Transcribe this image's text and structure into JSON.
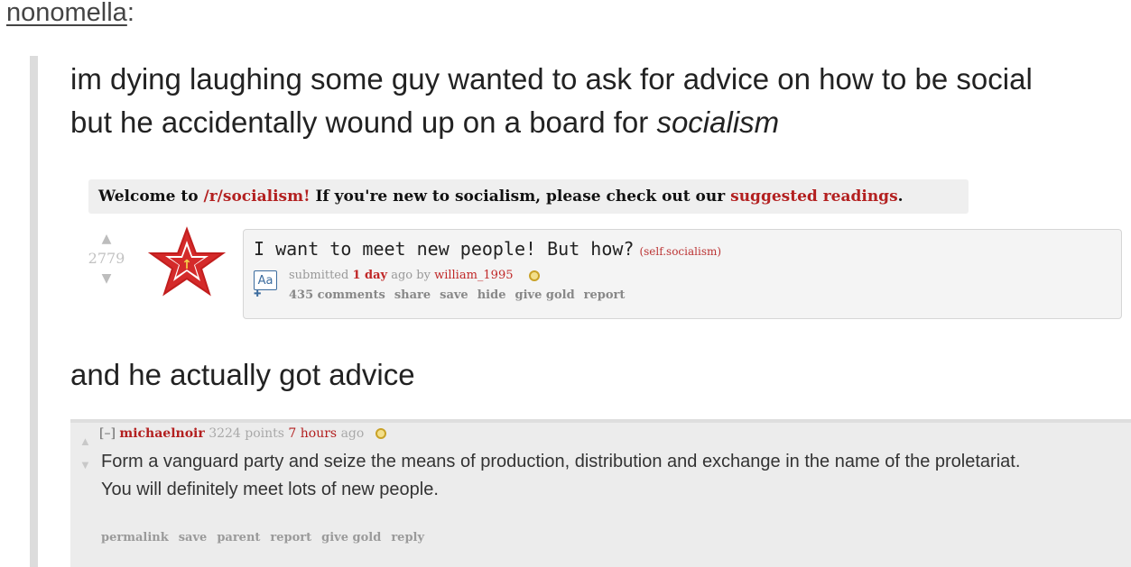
{
  "post": {
    "username": "nonomella",
    "username_suffix": ":",
    "quote_line1": "im dying laughing some guy wanted to ask for advice on how to be social",
    "quote_line2_prefix": "but he accidentally wound up on a board for ",
    "quote_line2_emphasis": "socialism",
    "followup": "and he actually got advice"
  },
  "subreddit_screenshot": {
    "banner_prefix": "Welcome to ",
    "banner_sub": "/r/socialism!",
    "banner_mid": " If you're new to socialism, please check out our ",
    "banner_link": "suggested readings",
    "banner_end": ".",
    "score": "2779",
    "title": "I want to meet new people! But how?",
    "domain": "(self.socialism)",
    "self_icon": "Aa",
    "meta_submitted": "submitted ",
    "meta_age": "1 day",
    "meta_by": " ago by ",
    "meta_author": "william_1995",
    "actions": [
      "435 comments",
      "share",
      "save",
      "hide",
      "give gold",
      "report"
    ],
    "icons": {
      "upvote": "upvote-icon",
      "downvote": "downvote-icon",
      "star": "red-star-icon",
      "gold": "gold-coin-icon"
    },
    "colors": {
      "accent_red": "#b32020",
      "link_blue": "#3c6c9e"
    }
  },
  "comment_screenshot": {
    "toggle": "[–]",
    "author": "michaelnoir",
    "points": "3224 points",
    "age": "7 hours",
    "ago": "ago",
    "body_p1": "Form a vanguard party and seize the means of production, distribution and exchange in the name of the proletariat.",
    "body_p2": "You will definitely meet lots of new people.",
    "actions": [
      "permalink",
      "save",
      "parent",
      "report",
      "give gold",
      "reply"
    ]
  }
}
